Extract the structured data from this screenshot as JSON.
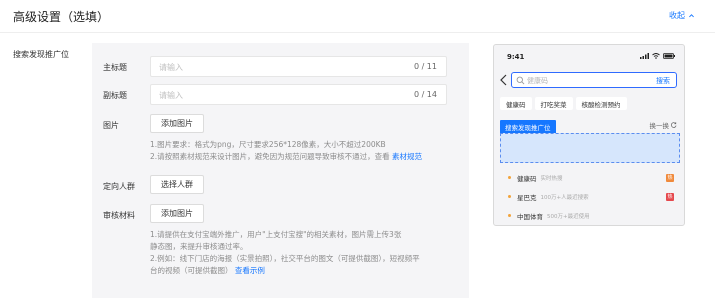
{
  "header": {
    "title": "高级设置（选填）",
    "collapse_label": "收起"
  },
  "section_label": "搜索发现推广位",
  "form": {
    "main_title": {
      "label": "主标题",
      "placeholder": "请输入",
      "counter": "0 / 11"
    },
    "sub_title": {
      "label": "副标题",
      "placeholder": "请输入",
      "counter": "0 / 14"
    },
    "image": {
      "label": "图片",
      "button": "添加图片",
      "hint_1": "1.图片要求：格式为png，尺寸要求256*128像素，大小不超过200KB",
      "hint_2": "2.请按照素材规范来设计图片，避免因为规范问题导致审核不通过，查看",
      "hint_link": "素材规范"
    },
    "audience": {
      "label": "定向人群",
      "button": "选择人群"
    },
    "review": {
      "label": "审核材料",
      "button": "添加图片",
      "hint_1a": "1.请提供在支付宝端外推广，用户\"上支付宝搜\"的相关素材，图片需上传3张",
      "hint_1b": "静态图，来提升审核通过率。",
      "hint_2a": "2.例如：线下门店的海报（实景拍照），社交平台的图文（可提供截图），短视频平",
      "hint_2b": "台的视频（可提供截图）",
      "hint_link": "查看示例"
    }
  },
  "preview": {
    "time": "9:41",
    "search_placeholder": "健康码",
    "search_button": "搜索",
    "chips": [
      "健康码",
      "打吃奖菜",
      "核酸检测预约"
    ],
    "ad_tag": "搜索发现推广位",
    "refresh_label": "换一换",
    "list": [
      {
        "title": "健康码",
        "sub": "实时热搜",
        "badge_color": "#f08a3c"
      },
      {
        "title": "星巴克",
        "sub": "100万+人最近搜索",
        "badge_color": "#e5484d"
      },
      {
        "title": "中国体育",
        "sub": "500万+最近使用",
        "badge_color": ""
      }
    ]
  },
  "colors": {
    "accent": "#1677ff",
    "panel_bg": "#f5f5f7",
    "ad_box_bg": "#d6e6fc"
  }
}
